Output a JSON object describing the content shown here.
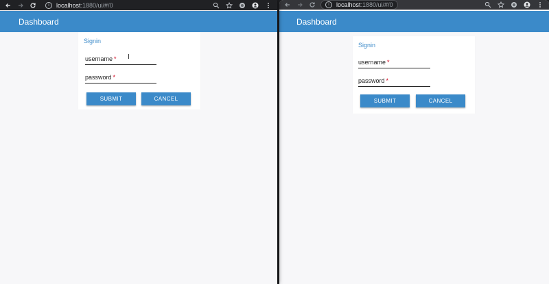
{
  "browser": {
    "url_host": "localhost",
    "url_path": ":1880/ui/#/0"
  },
  "app": {
    "title": "Dashboard"
  },
  "signin": {
    "title": "Signin",
    "username_label": "username",
    "password_label": "password",
    "required_mark": "*",
    "submit_label": "SUBMIT",
    "cancel_label": "CANCEL"
  },
  "colors": {
    "accent": "#3b8ac9",
    "required": "#d0021b"
  }
}
